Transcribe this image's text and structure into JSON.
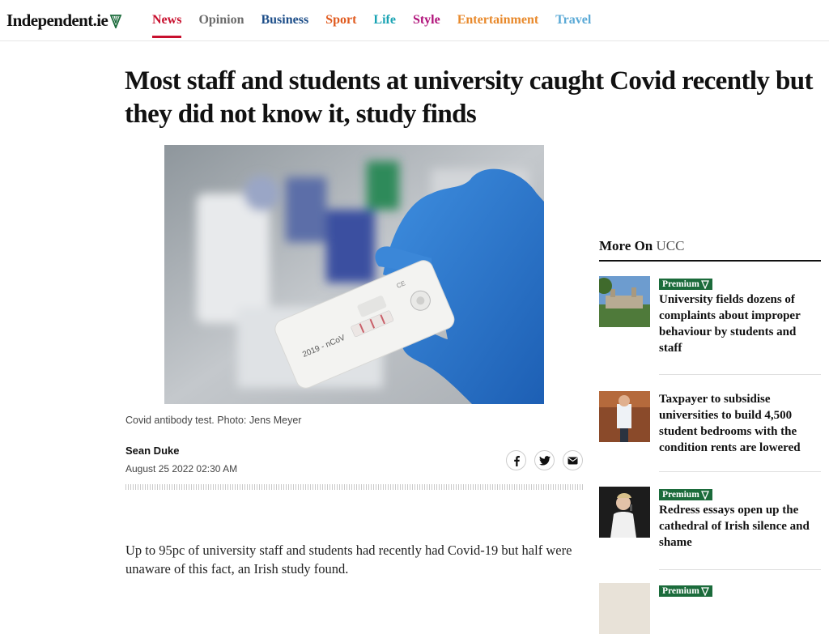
{
  "header": {
    "logo": "Independent.ie",
    "nav": [
      {
        "label": "News",
        "color": "#c8102e",
        "active": true
      },
      {
        "label": "Opinion",
        "color": "#6b6b6b"
      },
      {
        "label": "Business",
        "color": "#1d4e89"
      },
      {
        "label": "Sport",
        "color": "#e05a1e"
      },
      {
        "label": "Life",
        "color": "#19a3b3"
      },
      {
        "label": "Style",
        "color": "#b0127a"
      },
      {
        "label": "Entertainment",
        "color": "#e8892b"
      },
      {
        "label": "Travel",
        "color": "#5aa9d6"
      }
    ]
  },
  "article": {
    "headline": "Most staff and students at university caught Covid recently but they did not know it, study finds",
    "image_alt": "Covid antibody test cassette held in blue gloved hand, labelled 2019 - nCoV",
    "caption": "Covid antibody test. Photo: Jens Meyer",
    "author": "Sean Duke",
    "date": "August 25 2022 02:30 AM",
    "share_icons": [
      "facebook-icon",
      "twitter-icon",
      "email-icon"
    ],
    "body": "Up to 95pc of university staff and students had recently had Covid-19 but half were unaware of this fact, an Irish study found."
  },
  "sidebar": {
    "title_prefix": "More On",
    "title_topic": "UCC",
    "items": [
      {
        "premium": true,
        "premium_label": "Premium",
        "title": "University fields dozens of complaints about improper behaviour by students and staff"
      },
      {
        "premium": false,
        "title": "Taxpayer to subsidise universities to build 4,500 student bedrooms with the condition rents are lowered"
      },
      {
        "premium": true,
        "premium_label": "Premium",
        "title": "Redress essays open up the cathedral of Irish silence and shame"
      },
      {
        "premium": true,
        "premium_label": "Premium",
        "title": ""
      }
    ]
  },
  "colors": {
    "premium_green": "#1b6b3b",
    "accent_red": "#c8102e"
  }
}
